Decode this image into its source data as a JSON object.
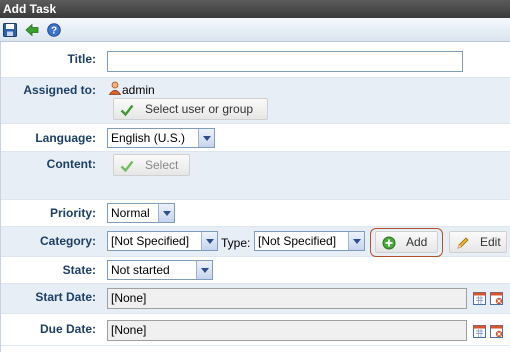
{
  "window": {
    "title": "Add Task"
  },
  "toolbar": {
    "save_icon": "save-icon",
    "back_icon": "back-arrow-icon",
    "help_icon": "help-icon"
  },
  "form": {
    "title": {
      "label": "Title:",
      "value": ""
    },
    "assigned": {
      "label": "Assigned to:",
      "user": "admin",
      "select_button": "Select user or group"
    },
    "language": {
      "label": "Language:",
      "value": "English (U.S.)"
    },
    "content": {
      "label": "Content:",
      "select_button": "Select"
    },
    "priority": {
      "label": "Priority:",
      "value": "Normal"
    },
    "category": {
      "label": "Category:",
      "value": "[Not Specified]",
      "type_label": "Type:",
      "type_value": "[Not Specified]",
      "add_button": "Add",
      "edit_button": "Edit"
    },
    "state": {
      "label": "State:",
      "value": "Not started"
    },
    "start_date": {
      "label": "Start Date:",
      "value": "[None]"
    },
    "due_date": {
      "label": "Due Date:",
      "value": "[None]"
    }
  },
  "colors": {
    "label_text": "#1c3f66",
    "alt_row": "#e8eef5",
    "highlight_border": "#b0512b"
  }
}
